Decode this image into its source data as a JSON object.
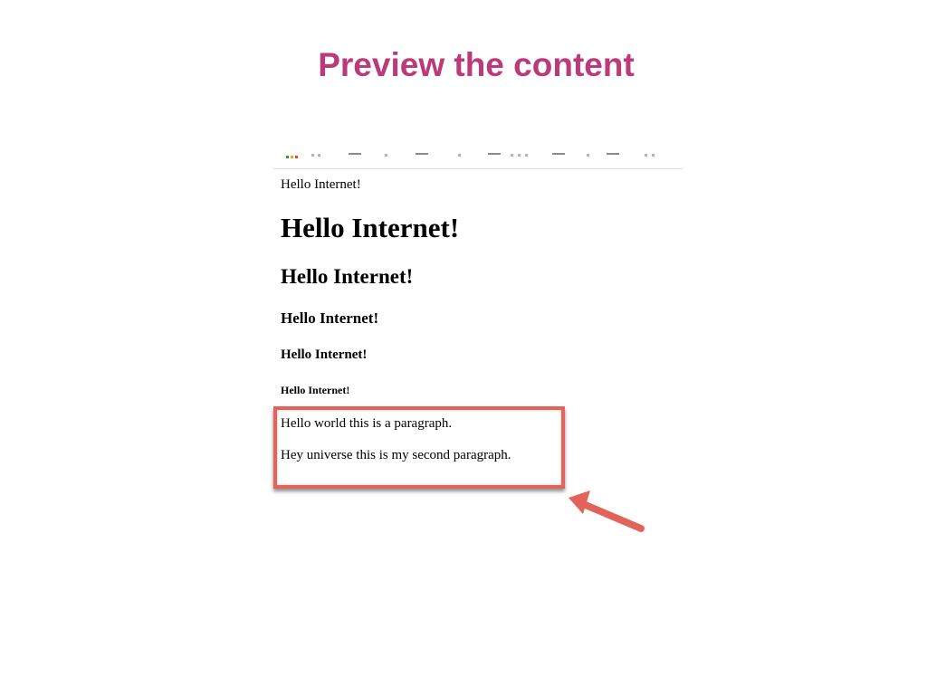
{
  "slide": {
    "title": "Preview the content",
    "title_color": "#bb3b7a",
    "highlight_color": "#e0645a"
  },
  "browser": {
    "bookmarks_bar_icon": "apps-grid-icon",
    "content": {
      "body_text": "Hello Internet!",
      "h1": "Hello Internet!",
      "h2": "Hello Internet!",
      "h3": "Hello Internet!",
      "h4": "Hello Internet!",
      "h5": "Hello Internet!",
      "paragraph_1": "Hello world this is a paragraph.",
      "paragraph_2": "Hey universe this is my second paragraph."
    }
  },
  "annotation": {
    "arrow_icon": "arrow-pointer-icon"
  }
}
